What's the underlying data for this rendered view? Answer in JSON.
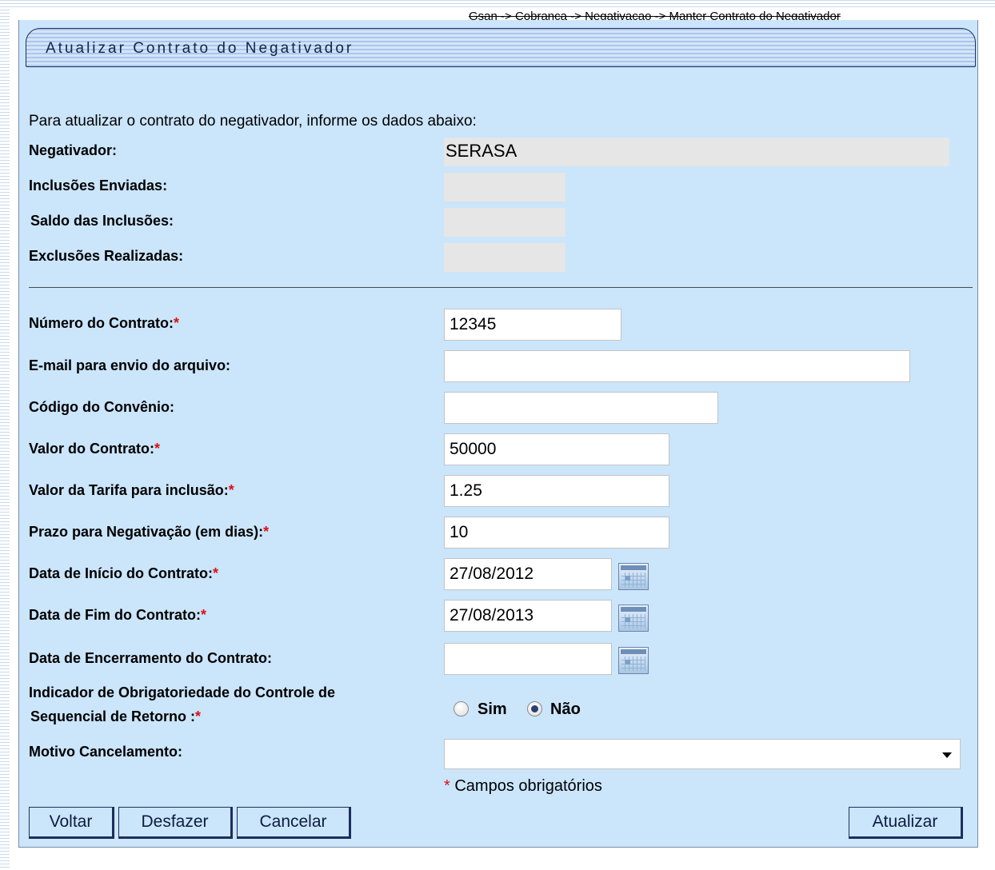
{
  "breadcrumb": "Gsan -> Cobranca -> Negativacao -> Manter Contrato do Negativador",
  "page_title": "Atualizar Contrato do Negativador",
  "intro": "Para atualizar o contrato do negativador, informe os dados abaixo:",
  "info": {
    "negativador_label": "Negativador:",
    "negativador_value": "SERASA",
    "inclusoes_enviadas_label": "Inclusões Enviadas:",
    "inclusoes_enviadas_value": "",
    "saldo_inclusoes_label": "Saldo das Inclusões:",
    "saldo_inclusoes_value": "",
    "exclusoes_realizadas_label": "Exclusões Realizadas:",
    "exclusoes_realizadas_value": ""
  },
  "form": {
    "numero_contrato": {
      "label": "Número do Contrato:",
      "value": "12345"
    },
    "email_envio": {
      "label": "E-mail para envio do arquivo:",
      "value": ""
    },
    "codigo_convenio": {
      "label": "Código do Convênio:",
      "value": ""
    },
    "valor_contrato": {
      "label": "Valor do Contrato:",
      "value": "50000"
    },
    "valor_tarifa": {
      "label": "Valor da Tarifa para inclusão:",
      "value": "1.25"
    },
    "prazo_negativacao": {
      "label": "Prazo para Negativação (em dias):",
      "value": "10"
    },
    "data_inicio": {
      "label": "Data de Início do Contrato:",
      "value": "27/08/2012"
    },
    "data_fim": {
      "label": "Data de Fim do Contrato:",
      "value": "27/08/2013"
    },
    "data_encerramento": {
      "label": "Data de Encerramento do Contrato:",
      "value": ""
    },
    "indicador_line1": "Indicador de Obrigatoriedade do Controle de",
    "indicador_line2": "Sequencial de Retorno :",
    "indicador_options": [
      "Sim",
      "Não"
    ],
    "indicador_selected": "Não",
    "motivo_cancelamento": {
      "label": "Motivo Cancelamento:",
      "value": ""
    }
  },
  "required_star": "*",
  "required_note": "Campos obrigatórios",
  "buttons": {
    "voltar": "Voltar",
    "desfazer": "Desfazer",
    "cancelar": "Cancelar",
    "atualizar": "Atualizar"
  },
  "colors": {
    "panel_bg": "#cbe5fb",
    "required_star": "#e01010",
    "title_text": "#14254a"
  },
  "icons": [
    "calendar-icon",
    "chevron-down-icon"
  ]
}
